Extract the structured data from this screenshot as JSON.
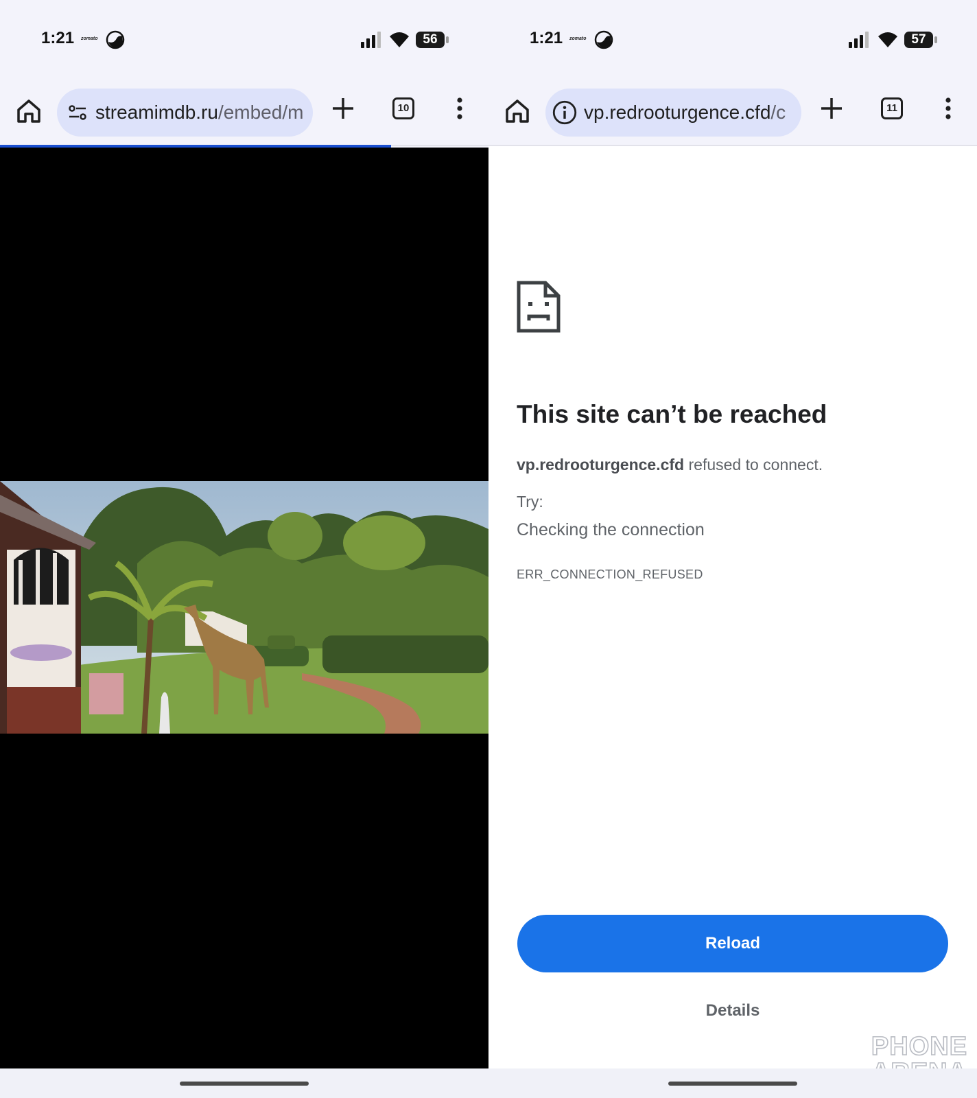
{
  "left_phone": {
    "status": {
      "time": "1:21",
      "brand": "zomato",
      "battery": "56"
    },
    "toolbar": {
      "url_host": "streamimdb.ru",
      "url_path": "/embed/m",
      "tab_count": "10"
    },
    "page_load_progress": 0.8
  },
  "right_phone": {
    "status": {
      "time": "1:21",
      "brand": "zomato",
      "battery": "57"
    },
    "toolbar": {
      "url_host": "vp.redrooturgence.cfd",
      "url_path": "/c",
      "tab_count": "11"
    },
    "error": {
      "title": "This site can’t be reached",
      "host": "vp.redrooturgence.cfd",
      "message": " refused to connect.",
      "try_label": "Try:",
      "suggestion": "Checking the connection",
      "code": "ERR_CONNECTION_REFUSED"
    },
    "buttons": {
      "reload": "Reload",
      "details": "Details"
    },
    "watermark": {
      "line1": "PHONE",
      "line2": "ARENA"
    }
  },
  "icons": {
    "home": "home-icon",
    "tune": "tune-icon",
    "info": "info-icon",
    "plus": "plus-icon",
    "menu": "more-vert-icon",
    "sad_page": "sad-page-icon"
  },
  "colors": {
    "accent": "#1a73e8",
    "omnibox": "#dde2fa",
    "progress": "#1b4fd0"
  }
}
